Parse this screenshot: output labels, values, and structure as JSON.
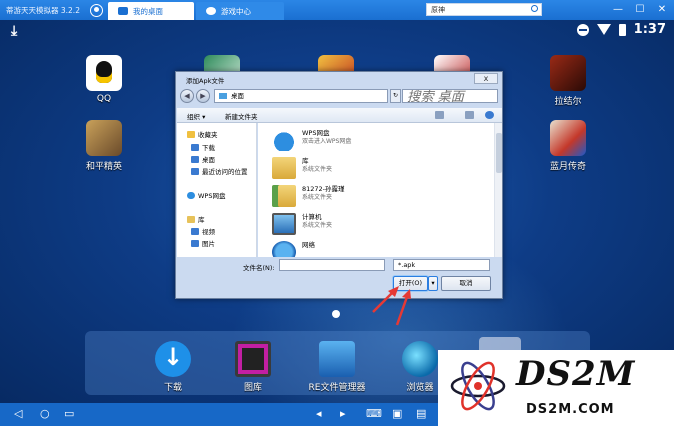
{
  "window": {
    "title": "蒂游天天模拟器 3.2.2",
    "tabs": [
      {
        "label": "我的桌面",
        "active": true
      },
      {
        "label": "游戏中心",
        "active": false
      }
    ],
    "search_value": "原神",
    "controls": {
      "minimize": "—",
      "maximize": "☐",
      "close": "✕"
    }
  },
  "status_bar": {
    "time": "1:37"
  },
  "desktop": {
    "apps": [
      {
        "label": "QQ",
        "icon": "qq-icon"
      },
      {
        "label": "和平精英",
        "icon": "peace-elite-icon"
      },
      {
        "label": "拉结尔",
        "icon": "lajieer-icon"
      },
      {
        "label": "蓝月传奇",
        "icon": "lanyue-icon"
      }
    ],
    "dock": [
      {
        "label": "下载",
        "icon": "download-icon"
      },
      {
        "label": "图库",
        "icon": "gallery-icon"
      },
      {
        "label": "RE文件管理器",
        "icon": "re-file-manager-icon"
      },
      {
        "label": "浏览器",
        "icon": "browser-icon"
      }
    ]
  },
  "dialog": {
    "title": "添加Apk文件",
    "close": "x",
    "address": "桌面",
    "search_placeholder": "搜索 桌面",
    "toolbar": {
      "organize": "组织 ▾",
      "new_folder": "新建文件夹"
    },
    "sidebar": [
      {
        "label": "收藏夹",
        "icon": "star-icon"
      },
      {
        "label": "下载",
        "icon": "download-folder-icon"
      },
      {
        "label": "桌面",
        "icon": "desktop-icon"
      },
      {
        "label": "最近访问的位置",
        "icon": "recent-icon"
      },
      {
        "label": "WPS网盘",
        "icon": "cloud-icon"
      },
      {
        "label": "库",
        "icon": "library-icon"
      },
      {
        "label": "视频",
        "icon": "video-icon"
      },
      {
        "label": "图片",
        "icon": "picture-icon"
      }
    ],
    "files": [
      {
        "name": "WPS网盘",
        "desc": "双击进入WPS网盘",
        "icon": "wps-cloud-icon"
      },
      {
        "name": "库",
        "desc": "系统文件夹",
        "icon": "library-folder-icon"
      },
      {
        "name": "81272-孙露瑾",
        "desc": "系统文件夹",
        "icon": "user-folder-icon"
      },
      {
        "name": "计算机",
        "desc": "系统文件夹",
        "icon": "computer-icon"
      },
      {
        "name": "网络",
        "desc": "",
        "icon": "network-icon"
      }
    ],
    "filename_label": "文件名(N):",
    "filename_value": "",
    "filetype": "*.apk",
    "open_button": "打开(O)",
    "cancel_button": "取消"
  },
  "watermark": {
    "title": "DS2M",
    "subtitle": "DS2M.COM"
  },
  "colors": {
    "titlebar": "#1a6fd1",
    "navbar": "#1768c7",
    "arrow": "#e53935"
  }
}
